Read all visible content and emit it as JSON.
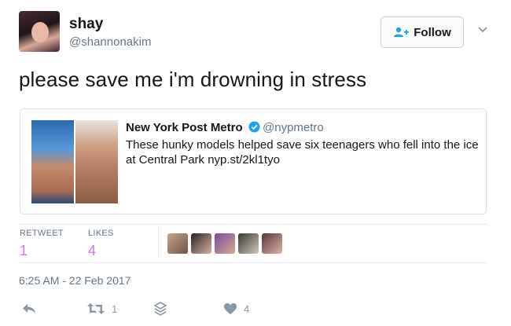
{
  "user": {
    "name": "shay",
    "handle": "@shannonakim"
  },
  "follow_button": {
    "label": "Follow"
  },
  "tweet": {
    "text": "please save me i'm drowning in stress"
  },
  "quoted_tweet": {
    "author": "New York Post Metro",
    "verified": true,
    "handle": "@nypmetro",
    "text": "These hunky models helped save six teenagers who fell into the ice at Central Park nyp.st/2kl1tyo"
  },
  "stats": {
    "retweets_label": "RETWEET",
    "retweets_count": "1",
    "likes_label": "LIKES",
    "likes_count": "4"
  },
  "timestamp": "6:25 AM - 22 Feb 2017",
  "actions": {
    "reply_icon": "reply-icon",
    "retweet_icon": "retweet-icon",
    "retweet_count": "1",
    "stack_icon": "layers-icon",
    "like_icon": "heart-icon",
    "like_count": "4"
  },
  "colors": {
    "accent": "#1da1f2",
    "stat_count": "#c87fd6",
    "muted": "#657786",
    "icon_gray": "#8899a6"
  }
}
